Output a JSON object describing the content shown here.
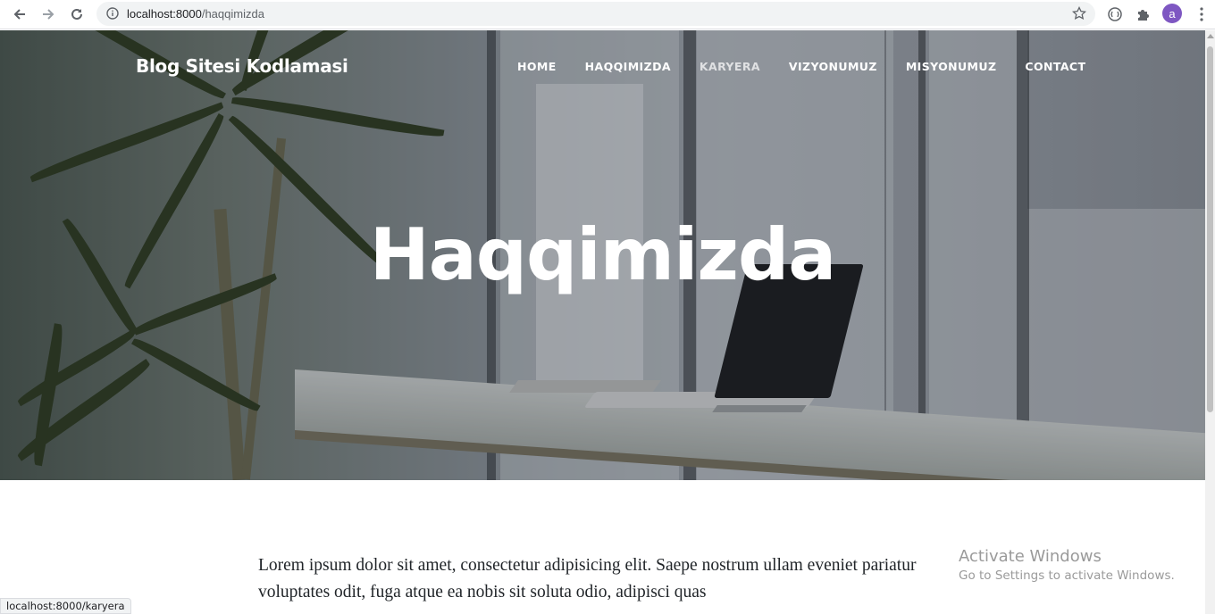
{
  "browser": {
    "url_host": "localhost:8000",
    "url_path": "/haqqimizda",
    "profile_initial": "a",
    "icons": [
      "back-arrow-icon",
      "forward-arrow-icon",
      "reload-icon",
      "info-icon",
      "star-icon",
      "extension-icon",
      "puzzle-icon",
      "menu-dots-icon"
    ],
    "status_link": "localhost:8000/karyera"
  },
  "site": {
    "brand": "Blog Sitesi Kodlamasi",
    "nav": [
      {
        "label": "HOME"
      },
      {
        "label": "HAQQIMIZDA"
      },
      {
        "label": "KARYERA"
      },
      {
        "label": "VIZYONUMUZ"
      },
      {
        "label": "MISYONUMUZ"
      },
      {
        "label": "CONTACT"
      }
    ],
    "hero_title": "Haqqimizda",
    "body_text": "Lorem ipsum dolor sit amet, consectetur adipisicing elit. Saepe nostrum ullam eveniet pariatur voluptates odit, fuga atque ea nobis sit soluta odio, adipisci quas"
  },
  "watermark": {
    "line1": "Activate Windows",
    "line2": "Go to Settings to activate Windows."
  },
  "colors": {
    "avatar": "#7e57c2",
    "text": "#212529"
  }
}
